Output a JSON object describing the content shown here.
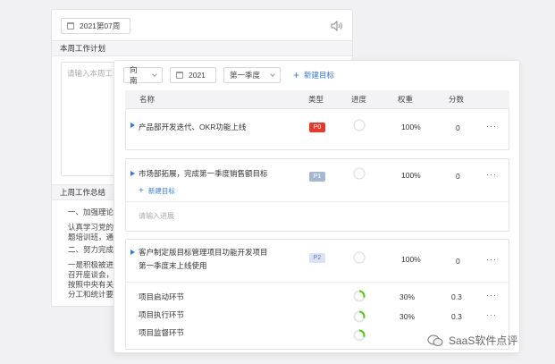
{
  "back": {
    "week_label": "2021第07周",
    "plan_title": "本周工作计划",
    "plan_placeholder": "请输入本周工作",
    "summary_title": "上周工作总结",
    "summary_lines": [
      "一、加强理论学",
      "认真学习党的十",
      "题培训班，通过",
      "二、努力完成扶",
      "一是积极被进",
      "召开座谈会，走",
      "按照中央有关要",
      "分工和统计要求"
    ]
  },
  "toolbar": {
    "owner": "向南",
    "year": "2021",
    "quarter": "第一季度",
    "add_goal": "新建目标"
  },
  "table": {
    "headers": {
      "name": "名称",
      "type": "类型",
      "progress": "进度",
      "weight": "权重",
      "score": "分数"
    }
  },
  "goals": [
    {
      "title": "产品部开发迭代、OKR功能上线",
      "type": "P0",
      "weight": "100%",
      "score": "0",
      "progress_fraction": 0
    },
    {
      "title": "市场部拓展，完成第一季度销售额目标",
      "type": "P1",
      "weight": "100%",
      "score": "0",
      "progress_fraction": 0,
      "add_sub": "新建目标",
      "progress_placeholder": "请输入进展"
    },
    {
      "title_line1": "客户制定版目标管理项目功能开发项目",
      "title_line2": "第一季度末上线使用",
      "type": "P2",
      "weight": "100%",
      "score": "0",
      "progress_fraction": 0,
      "key_results": [
        {
          "name": "项目启动环节",
          "weight": "30%",
          "score": "0.3",
          "progress_fraction": 0.3
        },
        {
          "name": "项目执行环节",
          "weight": "30%",
          "score": "0.3",
          "progress_fraction": 0.3
        },
        {
          "name": "项目监督环节",
          "weight": "",
          "score": "",
          "progress_fraction": 0.3
        }
      ]
    }
  ],
  "more_label": "···",
  "watermark": "SaaS软件点评",
  "colors": {
    "accent": "#3a7bd5",
    "p0": "#e23b2e",
    "p1": "#a7b7d2",
    "p2": "#d8e3f3",
    "ring": "#52c41a"
  }
}
